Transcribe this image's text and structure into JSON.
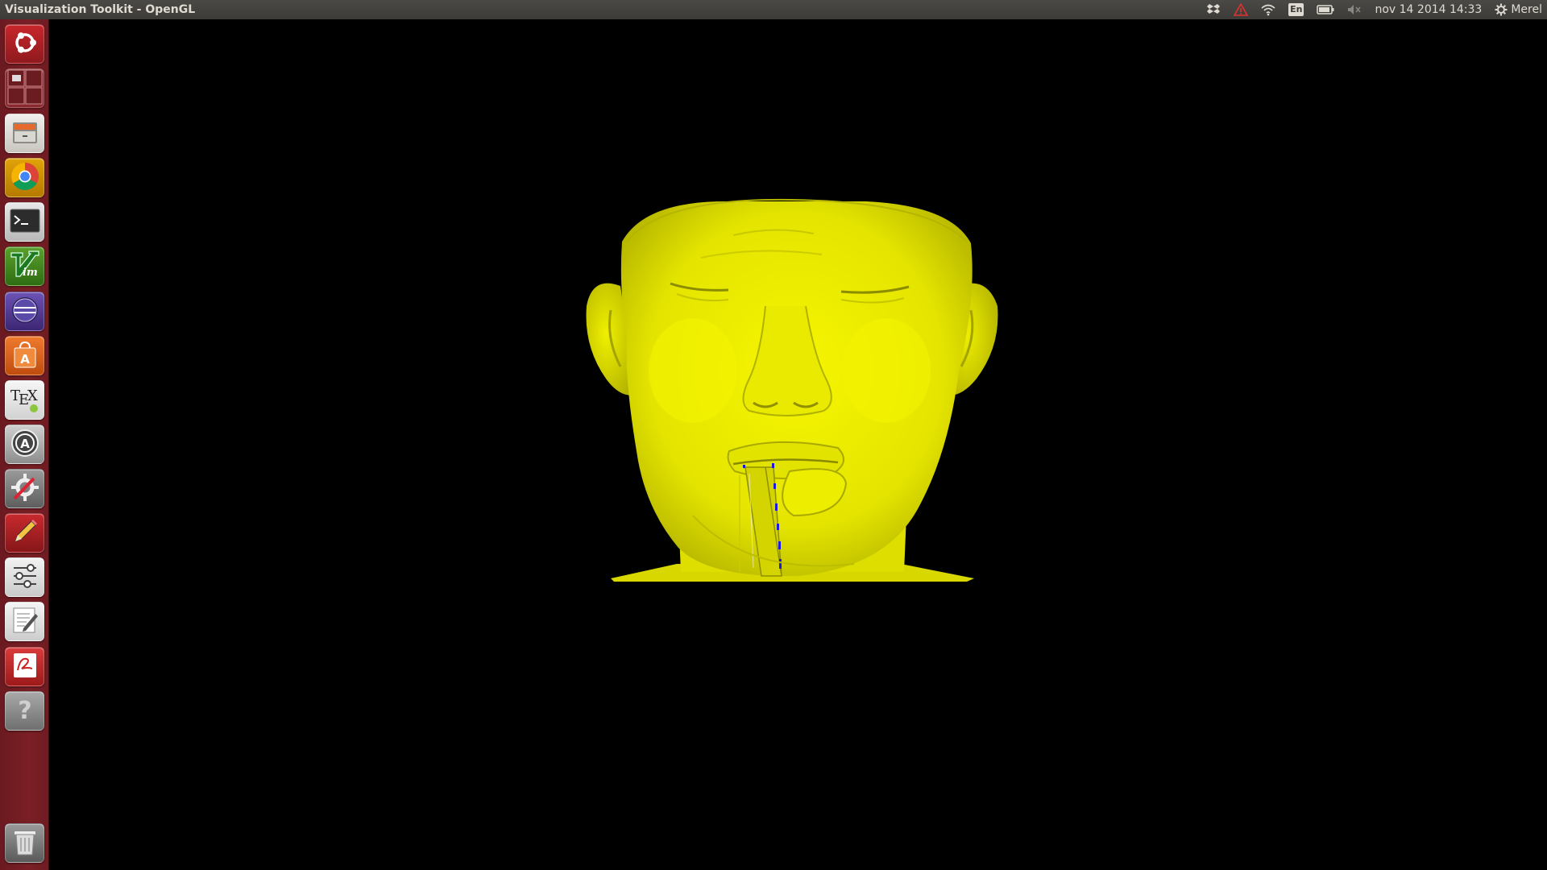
{
  "window": {
    "title": "Visualization Toolkit - OpenGL"
  },
  "tray": {
    "keyboard_layout": "En",
    "datetime": "nov 14 2014 14:33",
    "user": "Merel"
  },
  "launcher": {
    "items": [
      {
        "name": "Dash home",
        "icon": "ubuntu-logo-icon"
      },
      {
        "name": "Workspace switcher",
        "icon": "workspace-switcher-icon"
      },
      {
        "name": "Files",
        "icon": "file-cabinet-icon"
      },
      {
        "name": "Chrome",
        "icon": "chrome-icon"
      },
      {
        "name": "Terminal",
        "icon": "terminal-icon"
      },
      {
        "name": "Vim",
        "icon": "vim-icon"
      },
      {
        "name": "Eclipse",
        "icon": "eclipse-icon"
      },
      {
        "name": "Software Center",
        "icon": "software-center-icon"
      },
      {
        "name": "TeX",
        "icon": "tex-icon"
      },
      {
        "name": "Software Updater",
        "icon": "software-updater-icon"
      },
      {
        "name": "System Settings",
        "icon": "settings-icon"
      },
      {
        "name": "Editor",
        "icon": "pencil-icon"
      },
      {
        "name": "Settings Manager",
        "icon": "sliders-icon"
      },
      {
        "name": "Text Editor",
        "icon": "text-editor-icon"
      },
      {
        "name": "Document Viewer",
        "icon": "document-viewer-icon"
      },
      {
        "name": "Unknown application",
        "icon": "question-icon"
      },
      {
        "name": "Trash",
        "icon": "trash-icon"
      }
    ]
  },
  "scene": {
    "object": "head surface render",
    "surface_color": "#f2f200",
    "background": "#000000"
  },
  "colors": {
    "panel": "#3c3b37",
    "launcher": "#7a1f25",
    "highlight_blue": "#1b1bd8"
  }
}
